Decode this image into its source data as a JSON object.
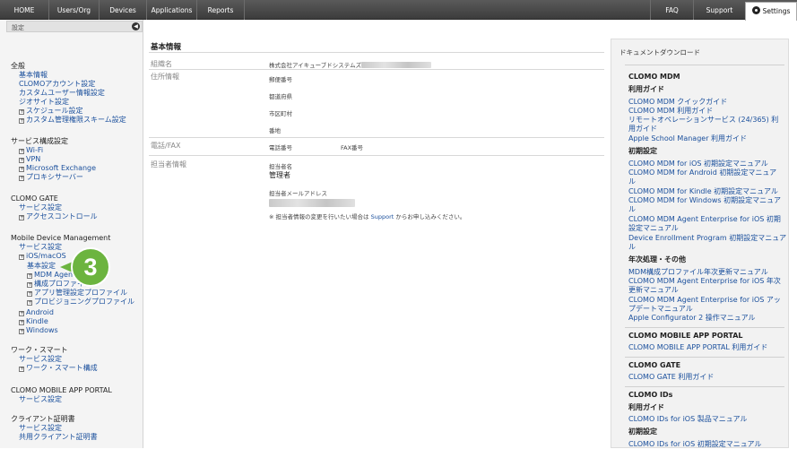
{
  "topnav": {
    "left": [
      "HOME",
      "Users/Org",
      "Devices",
      "Applications",
      "Reports"
    ],
    "faq": "FAQ",
    "support": "Support",
    "settings": "Settings"
  },
  "sidebar": {
    "header": "設定",
    "lines": [
      {
        "text": "全般",
        "kind": "section"
      },
      {
        "text": "基本情報",
        "kind": "link"
      },
      {
        "text": "CLOMOアカウント設定",
        "kind": "link"
      },
      {
        "text": "カスタムユーザー情報設定",
        "kind": "link"
      },
      {
        "text": "ジオサイト設定",
        "kind": "link"
      },
      {
        "text": "スケジュール設定",
        "kind": "expand"
      },
      {
        "text": "カスタム管理権限スキーム設定",
        "kind": "expand"
      },
      {
        "text": "サービス構成設定",
        "kind": "section"
      },
      {
        "text": "Wi-Fi",
        "kind": "expand"
      },
      {
        "text": "VPN",
        "kind": "expand"
      },
      {
        "text": "Microsoft Exchange",
        "kind": "expand"
      },
      {
        "text": "プロキシサーバー",
        "kind": "expand"
      },
      {
        "text": "CLOMO GATE",
        "kind": "section"
      },
      {
        "text": "サービス設定",
        "kind": "link"
      },
      {
        "text": "アクセスコントロール",
        "kind": "expand"
      },
      {
        "text": "Mobile Device Management",
        "kind": "section"
      },
      {
        "text": "サービス設定",
        "kind": "link"
      },
      {
        "text": "iOS/macOS",
        "kind": "expand"
      },
      {
        "text": "基本設定",
        "kind": "link"
      },
      {
        "text": "MDM Agent",
        "kind": "expand"
      },
      {
        "text": "構成プロファイル",
        "kind": "expand"
      },
      {
        "text": "アプリ管理設定プロファイル",
        "kind": "expand"
      },
      {
        "text": "プロビジョニングプロファイル",
        "kind": "expand"
      },
      {
        "text": "Android",
        "kind": "expand"
      },
      {
        "text": "Kindle",
        "kind": "expand"
      },
      {
        "text": "Windows",
        "kind": "expand"
      },
      {
        "text": "ワーク・スマート",
        "kind": "section"
      },
      {
        "text": "サービス設定",
        "kind": "link"
      },
      {
        "text": "ワーク・スマート構成",
        "kind": "expand"
      },
      {
        "text": "CLOMO MOBILE APP PORTAL",
        "kind": "section"
      },
      {
        "text": "サービス設定",
        "kind": "link"
      },
      {
        "text": "クライアント証明書",
        "kind": "section"
      },
      {
        "text": "サービス設定",
        "kind": "link"
      },
      {
        "text": "共用クライアント証明書",
        "kind": "link"
      }
    ],
    "step_badge": "3"
  },
  "main": {
    "title": "基本情報",
    "org_label": "組織名",
    "org_value": "株式会社アイキューブドシステムズ",
    "address_label": "住所情報",
    "postal": "郵便番号",
    "prefecture": "都道府県",
    "city": "市区町村",
    "street": "番地",
    "phone_label": "電話/FAX",
    "phone": "電話番号",
    "fax": "FAX番号",
    "contact_label": "担当者情報",
    "contact_name_label": "担当者名",
    "contact_name": "管理者",
    "contact_email_label": "担当者メールアドレス",
    "note_prefix": "※ 担当者情報の変更を行いたい場合は",
    "note_link": "Support",
    "note_suffix": "からお申し込みください。"
  },
  "rightpanel": {
    "title": "ドキュメントダウンロード",
    "lines": [
      {
        "text": "CLOMO MDM",
        "kind": "head"
      },
      {
        "text": "利用ガイド",
        "kind": "head"
      },
      {
        "text": "CLOMO MDM クイックガイド",
        "kind": "link"
      },
      {
        "text": "CLOMO MDM 利用ガイド",
        "kind": "link"
      },
      {
        "text": "リモートオペレーションサービス (24/365) 利",
        "kind": "link"
      },
      {
        "text": "用ガイド",
        "kind": "link"
      },
      {
        "text": "Apple School Manager 利用ガイド",
        "kind": "link"
      },
      {
        "text": "初期設定",
        "kind": "head"
      },
      {
        "text": "CLOMO MDM for iOS 初期設定マニュアル",
        "kind": "link"
      },
      {
        "text": "CLOMO MDM for Android 初期設定マニュア",
        "kind": "link"
      },
      {
        "text": "ル",
        "kind": "link"
      },
      {
        "text": "CLOMO MDM for Kindle 初期設定マニュアル",
        "kind": "link"
      },
      {
        "text": "CLOMO MDM for Windows 初期設定マニュア",
        "kind": "link"
      },
      {
        "text": "ル",
        "kind": "link"
      },
      {
        "text": "CLOMO MDM Agent Enterprise for iOS 初期",
        "kind": "link"
      },
      {
        "text": "設定マニュアル",
        "kind": "link"
      },
      {
        "text": "Device Enrollment Program 初期設定マニュア",
        "kind": "link"
      },
      {
        "text": "ル",
        "kind": "link"
      },
      {
        "text": "年次処理・その他",
        "kind": "head"
      },
      {
        "text": "MDM構成プロファイル年次更新マニュアル",
        "kind": "link"
      },
      {
        "text": "CLOMO MDM Agent Enterprise for iOS 年次",
        "kind": "link"
      },
      {
        "text": "更新マニュアル",
        "kind": "link"
      },
      {
        "text": "CLOMO MDM Agent Enterprise for iOS アッ",
        "kind": "link"
      },
      {
        "text": "プデートマニュアル",
        "kind": "link"
      },
      {
        "text": "Apple Configurator 2 操作マニュアル",
        "kind": "link"
      },
      {
        "text": "CLOMO MOBILE APP PORTAL",
        "kind": "head"
      },
      {
        "text": "CLOMO MOBILE APP PORTAL 利用ガイド",
        "kind": "link"
      },
      {
        "text": "CLOMO GATE",
        "kind": "head"
      },
      {
        "text": "CLOMO GATE 利用ガイド",
        "kind": "link"
      },
      {
        "text": "CLOMO IDs",
        "kind": "head"
      },
      {
        "text": "利用ガイド",
        "kind": "head"
      },
      {
        "text": "CLOMO IDs for iOS 製品マニュアル",
        "kind": "link"
      },
      {
        "text": "初期設定",
        "kind": "head"
      },
      {
        "text": "CLOMO IDs for iOS 初期設定マニュアル",
        "kind": "link"
      }
    ]
  }
}
